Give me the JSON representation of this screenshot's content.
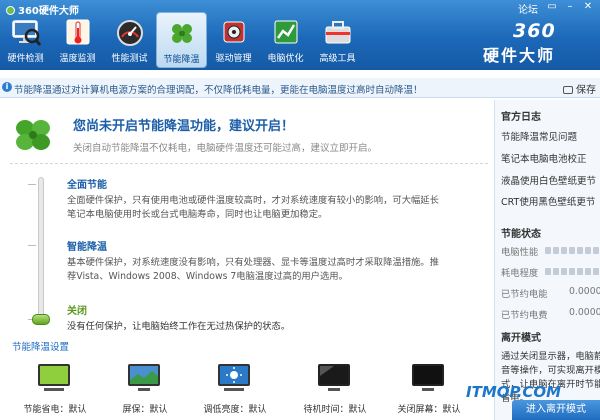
{
  "app": {
    "title": "360硬件大师",
    "forum": "论坛"
  },
  "nav": [
    {
      "label": "硬件检测",
      "icon": "monitor-magnifier-icon"
    },
    {
      "label": "温度监测",
      "icon": "thermometer-icon"
    },
    {
      "label": "性能测试",
      "icon": "speedometer-icon"
    },
    {
      "label": "节能降温",
      "icon": "clover-icon"
    },
    {
      "label": "驱动管理",
      "icon": "driver-chip-icon"
    },
    {
      "label": "电脑优化",
      "icon": "chart-optimize-icon"
    },
    {
      "label": "高级工具",
      "icon": "toolbox-icon"
    }
  ],
  "nav_active": "节能降温",
  "brand": {
    "num": "360",
    "name": "硬件大师"
  },
  "infobar": {
    "text": "节能降温通过对计算机电源方案的合理调配，不仅降低耗电量，更能在电脑温度过高时自动降温！",
    "save": "保存"
  },
  "notice": {
    "title": "您尚未开启节能降温功能，建议开启！",
    "subtitle": "关闭自动节能降温不仅耗电，电脑硬件温度还可能过高，建议立即开启。"
  },
  "modes": [
    {
      "title": "全面节能",
      "desc_line1": "全面硬件保护，只有使用电池或硬件温度较高时，才对系统速度有较小的影响，可大幅延长",
      "desc_line2": "笔记本电脑使用时长或台式电脑寿命，同时也让电脑更加稳定。"
    },
    {
      "title": "智能降温",
      "desc_line1": "基本硬件保护，对系统速度没有影响，只有处理器、显卡等温度过高时才采取降温措施。推",
      "desc_line2": "荐Vista、Windows 2008、Windows 7电脑温度过高的用户选用。"
    },
    {
      "title": "关闭",
      "desc_line1": "没有任何保护，让电脑始终工作在无过热保护的状态。"
    }
  ],
  "selected_mode": "关闭",
  "settings_link": "节能降温设置",
  "devices": [
    {
      "label": "节能省电：默认",
      "icon": "battery-screen-icon"
    },
    {
      "label": "屏保：默认",
      "icon": "screensaver-icon"
    },
    {
      "label": "调低亮度：默认",
      "icon": "brightness-icon"
    },
    {
      "label": "待机时间：默认",
      "icon": "standby-monitor-icon"
    },
    {
      "label": "关闭屏幕：默认",
      "icon": "screen-off-icon"
    }
  ],
  "panel": {
    "log_title": "官方日志",
    "logs": [
      "节能降温常见问题",
      "笔记本电脑电池校正",
      "液晶使用白色壁纸更节",
      "CRT使用黑色壁纸更节"
    ],
    "status_title": "节能状态",
    "stats": [
      {
        "label": "电脑性能",
        "type": "bar"
      },
      {
        "label": "耗电程度",
        "type": "bar"
      },
      {
        "label": "已节约电能",
        "value": "0.0000"
      },
      {
        "label": "已节约电费",
        "value": "0.0000"
      }
    ],
    "mode_title": "离开模式",
    "mode_desc": "通过关闭显示器，电脑静音等操作，可实现离开模式，让电脑在离开时节能省电。"
  },
  "enter_button": "进入离开模式",
  "watermark": "ITMOP.COM"
}
